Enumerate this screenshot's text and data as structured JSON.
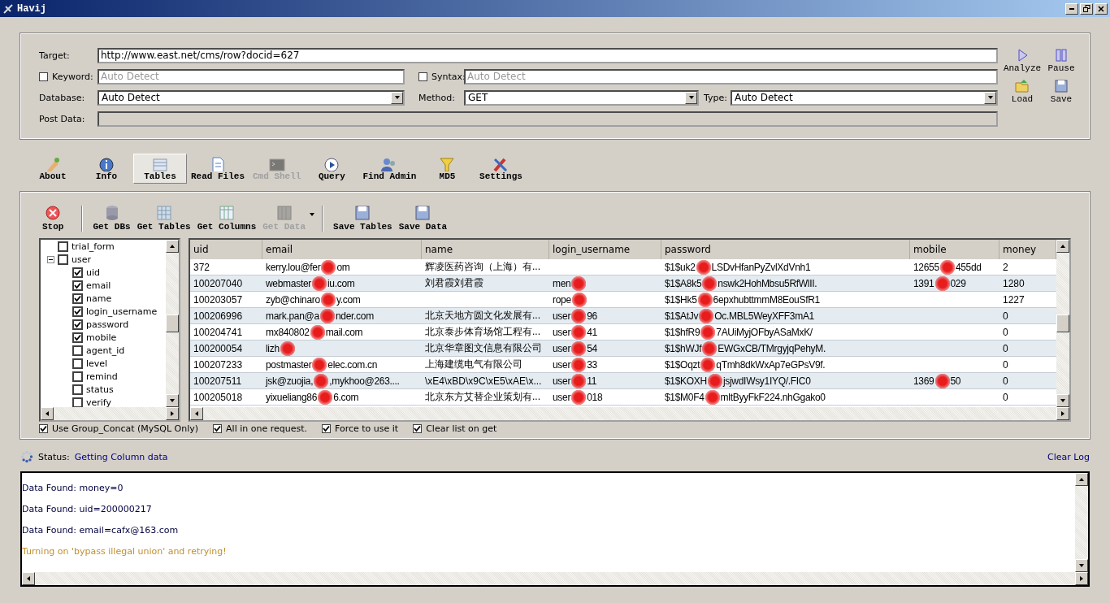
{
  "window": {
    "title": "Havij"
  },
  "form": {
    "target": {
      "label": "Target:",
      "value": "http://www.east.net/cms/row?docid=627"
    },
    "keyword": {
      "label": "Keyword:",
      "checked": false,
      "placeholder": "Auto Detect"
    },
    "syntax": {
      "label": "Syntax:",
      "checked": false,
      "placeholder": "Auto Detect"
    },
    "database": {
      "label": "Database:",
      "value": "Auto Detect"
    },
    "method": {
      "label": "Method:",
      "value": "GET"
    },
    "type": {
      "label": "Type:",
      "value": "Auto Detect"
    },
    "post_data": {
      "label": "Post Data:",
      "disabled": true
    },
    "actions": [
      "Analyze",
      "Pause",
      "Load",
      "Save"
    ]
  },
  "tabs": [
    {
      "label": "About",
      "selected": false,
      "disabled": false
    },
    {
      "label": "Info",
      "selected": false,
      "disabled": false
    },
    {
      "label": "Tables",
      "selected": true,
      "disabled": false
    },
    {
      "label": "Read Files",
      "selected": false,
      "disabled": false
    },
    {
      "label": "Cmd Shell",
      "selected": false,
      "disabled": true
    },
    {
      "label": "Query",
      "selected": false,
      "disabled": false
    },
    {
      "label": "Find Admin",
      "selected": false,
      "disabled": false
    },
    {
      "label": "MD5",
      "selected": false,
      "disabled": false
    },
    {
      "label": "Settings",
      "selected": false,
      "disabled": false
    }
  ],
  "toolbar": [
    {
      "label": "Stop",
      "disabled": false
    },
    {
      "label": "Get DBs",
      "disabled": false
    },
    {
      "label": "Get Tables",
      "disabled": false
    },
    {
      "label": "Get Columns",
      "disabled": false
    },
    {
      "label": "Get Data",
      "disabled": true
    },
    {
      "label": "Save Tables",
      "disabled": false
    },
    {
      "label": "Save Data",
      "disabled": false
    }
  ],
  "tree": [
    {
      "label": "trial_form",
      "checked": false
    },
    {
      "label": "user",
      "checked": false,
      "expanded": true,
      "children": [
        {
          "label": "uid",
          "checked": true
        },
        {
          "label": "email",
          "checked": true
        },
        {
          "label": "name",
          "checked": true
        },
        {
          "label": "login_username",
          "checked": true
        },
        {
          "label": "password",
          "checked": true
        },
        {
          "label": "mobile",
          "checked": true
        },
        {
          "label": "agent_id",
          "checked": false
        },
        {
          "label": "level",
          "checked": false
        },
        {
          "label": "remind",
          "checked": false
        },
        {
          "label": "status",
          "checked": false
        },
        {
          "label": "verify",
          "checked": false
        }
      ]
    }
  ],
  "table": {
    "columns": [
      "uid",
      "email",
      "name",
      "login_username",
      "password",
      "mobile",
      "money"
    ],
    "rows": [
      [
        "372",
        [
          "kerry.lou@fer",
          "om"
        ],
        "辉凌医药咨询（上海）有...",
        "",
        [
          "$1$uk2",
          "LSDvHfanPyZvlXdVnh1"
        ],
        [
          "12655",
          "455dd"
        ],
        "2"
      ],
      [
        "100207040",
        [
          "webmaster",
          "iu.com"
        ],
        "刘君霞刘君霞",
        [
          "men",
          ""
        ],
        [
          "$1$A8k5",
          "nswk2HohMbsu5RfWlII."
        ],
        [
          "1391",
          "029"
        ],
        "1280"
      ],
      [
        "100203057",
        [
          "zyb@chinaro",
          "y.com"
        ],
        "",
        [
          "rope",
          ""
        ],
        [
          "$1$Hk5",
          "6epxhubttmmM8EouSfR1"
        ],
        "",
        "1227"
      ],
      [
        "100206996",
        [
          "mark.pan@a",
          "nder.com"
        ],
        "北京天地方圆文化发展有...",
        [
          "user",
          "96"
        ],
        [
          "$1$AtJv",
          "Oc.MBL5WeyXFF3mA1"
        ],
        "",
        "0"
      ],
      [
        "100204741",
        [
          "mx840802",
          "mail.com"
        ],
        "北京泰步体育场馆工程有...",
        [
          "user",
          "41"
        ],
        [
          "$1$hfR9",
          "7AUiMyjOFbyASaMxK/"
        ],
        "",
        "0"
      ],
      [
        "100200054",
        [
          "lizh",
          ""
        ],
        "北京华章图文信息有限公司",
        [
          "user",
          "54"
        ],
        [
          "$1$hWJf",
          "EWGxCB/TMrgyjqPehyM."
        ],
        "",
        "0"
      ],
      [
        "100207233",
        [
          "postmaster",
          "elec.com.cn"
        ],
        "上海建缆电气有限公司",
        [
          "user",
          "33"
        ],
        [
          "$1$Oqzt",
          "qTmh8dkWxAp7eGPsV9f."
        ],
        "",
        "0"
      ],
      [
        "100207511",
        [
          "jsk@zuojia,",
          ",mykhoo@263...."
        ],
        "\\xE4\\xBD\\x9C\\xE5\\xAE\\x...",
        [
          "user",
          "11"
        ],
        [
          "$1$KOXH",
          "jsjwdIWsy1IYQ/.FIC0"
        ],
        [
          "1369",
          "50"
        ],
        "0"
      ],
      [
        "100205018",
        [
          "yixueliang86",
          "6.com"
        ],
        "北京东方艾替企业策划有...",
        [
          "user",
          "018"
        ],
        [
          "$1$M0F4",
          "mltByyFkF224.nhGgako0"
        ],
        "",
        "0"
      ]
    ]
  },
  "options": [
    {
      "label": "Use Group_Concat (MySQL Only)",
      "checked": true
    },
    {
      "label": "All in one request.",
      "checked": true
    },
    {
      "label": "Force to use it",
      "checked": true
    },
    {
      "label": "Clear list on get",
      "checked": true
    }
  ],
  "status": {
    "label": "Status:",
    "value": "Getting Column data",
    "clear": "Clear Log"
  },
  "log": [
    {
      "text": "Data Found: money=0",
      "kind": "info"
    },
    {
      "text": "Data Found: uid=200000217",
      "kind": "info"
    },
    {
      "text": "Data Found: email=cafx@163.com",
      "kind": "info"
    },
    {
      "text": "Turning on 'bypass illegal union' and retrying!",
      "kind": "warning"
    }
  ]
}
